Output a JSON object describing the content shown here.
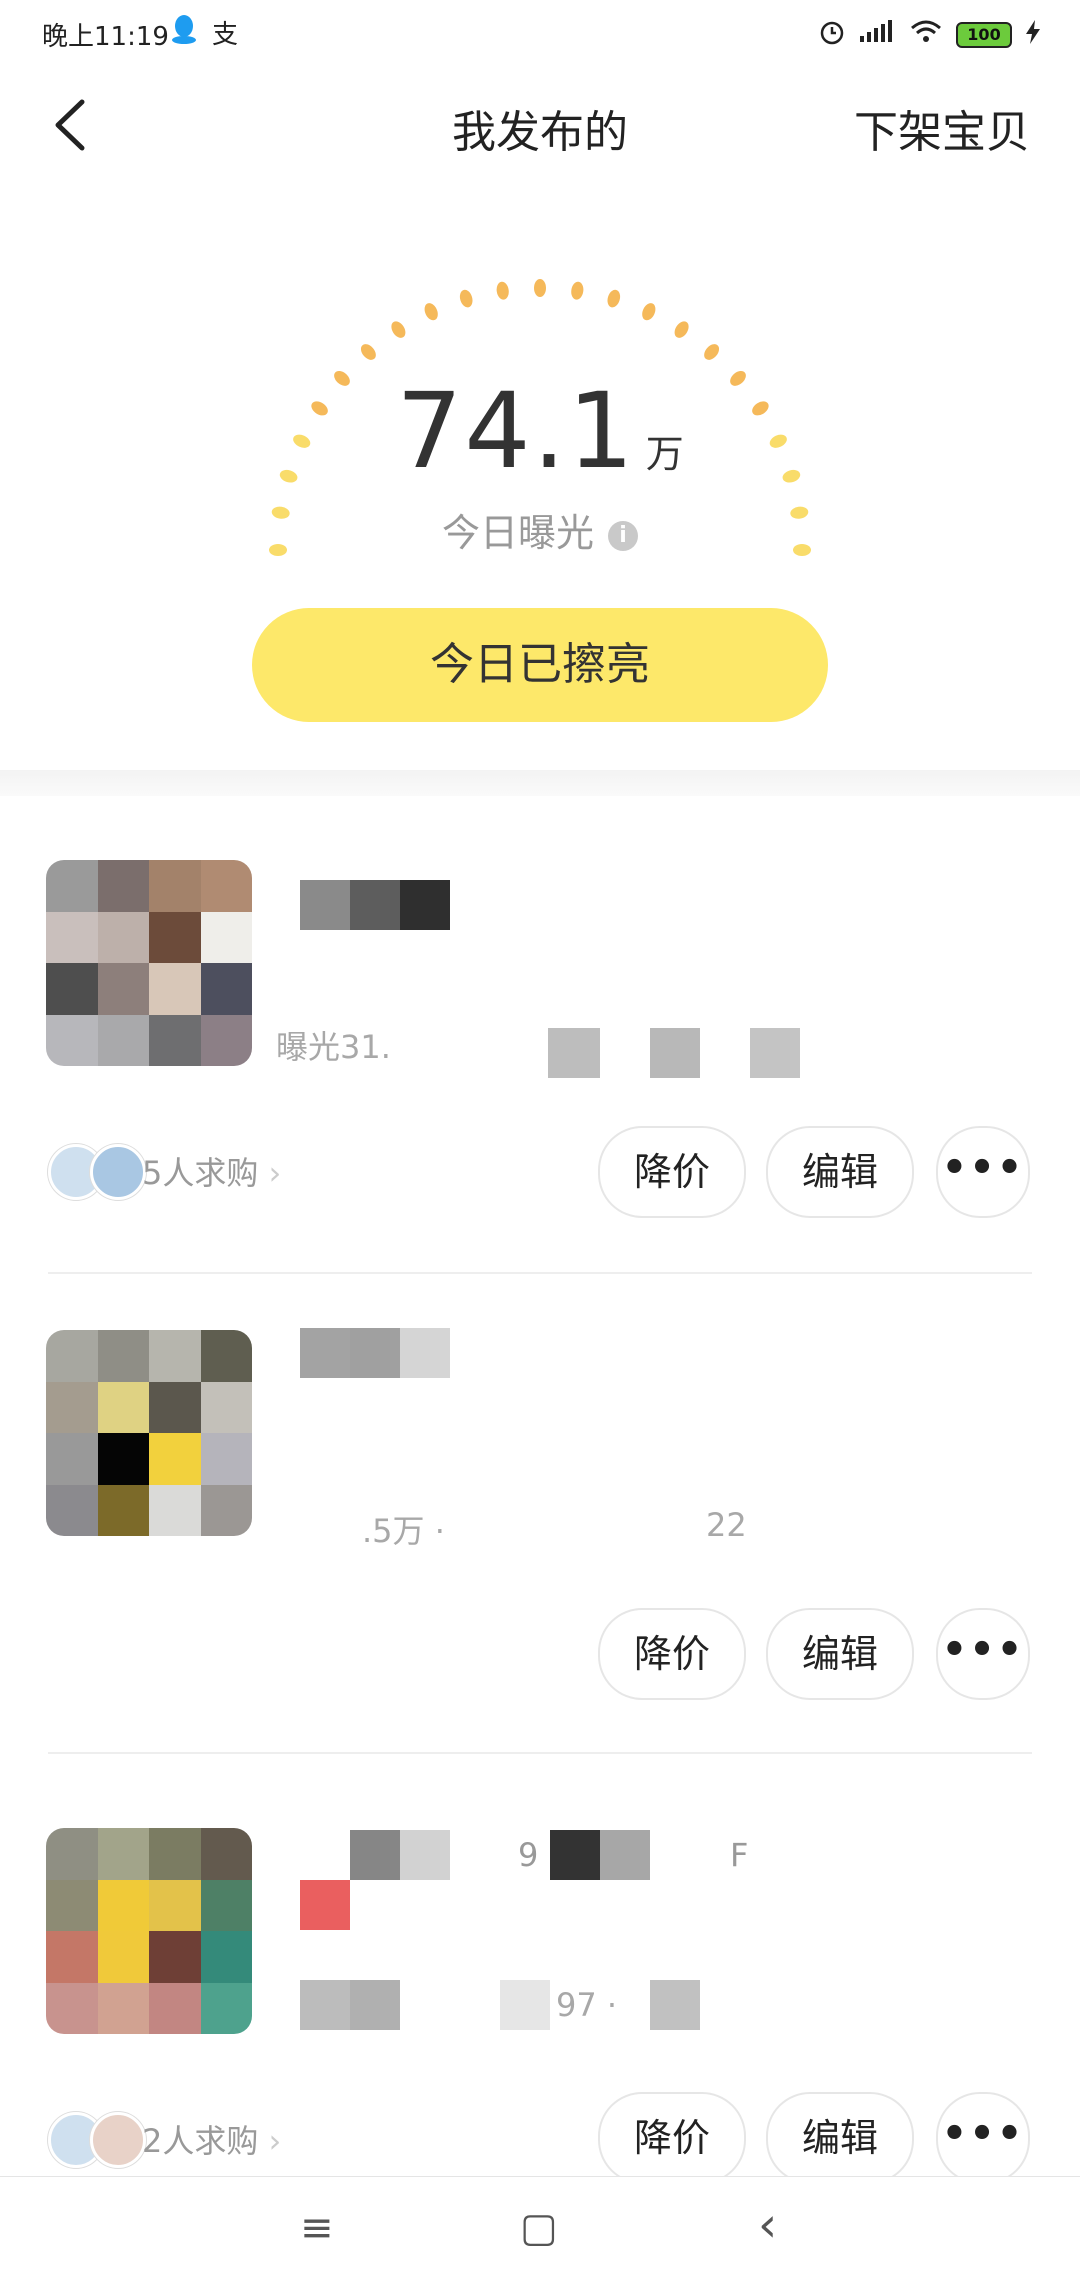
{
  "status_bar": {
    "time": "晚上11:19",
    "left_icons": [
      "qq-icon",
      "alipay-icon"
    ],
    "right_icons": [
      "alarm-icon",
      "signal-icon",
      "wifi-icon",
      "battery-icon",
      "charging-icon"
    ],
    "battery": "100",
    "alipay_glyph": "支"
  },
  "header": {
    "title": "我发布的",
    "right_action": "下架宝贝"
  },
  "summary": {
    "exposure_value": "74.1",
    "exposure_unit": "万",
    "exposure_label": "今日曝光",
    "info_glyph": "i",
    "polish_button": "今日已擦亮"
  },
  "items": [
    {
      "meta": "曝光31.",
      "wanted": "5人求购",
      "actions": {
        "price_down": "降价",
        "edit": "编辑",
        "more": "•••"
      }
    },
    {
      "meta": ".5万 ·",
      "meta_tail": "22",
      "actions": {
        "price_down": "降价",
        "edit": "编辑",
        "more": "•••"
      }
    },
    {
      "meta": "97 ·",
      "title_tail": "9",
      "title_tail2": "F",
      "wanted": "2人求购",
      "actions": {
        "price_down": "降价",
        "edit": "编辑",
        "more": "•••"
      }
    }
  ],
  "bottom_nav": {
    "menu_icon": "≡",
    "home_icon": "▢",
    "back_icon": "‹"
  },
  "colors": {
    "accent_yellow": "#fde86a",
    "gauge_dot": "#f5b95a",
    "gauge_dot_light": "#f9dc6a"
  }
}
